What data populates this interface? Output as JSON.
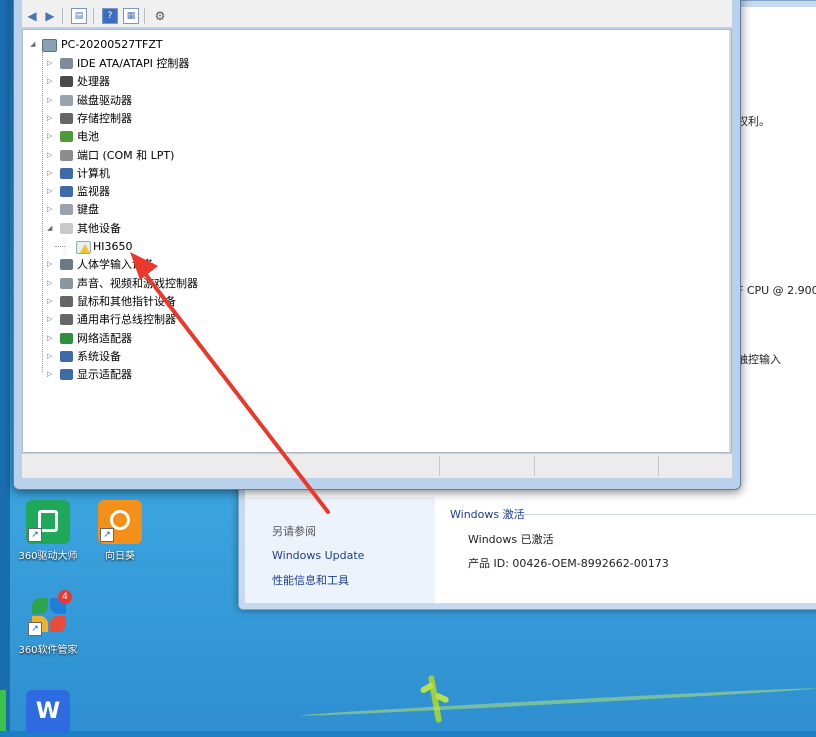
{
  "device_manager": {
    "root": "PC-20200527TFZT",
    "categories": [
      {
        "label": "IDE ATA/ATAPI 控制器",
        "icon": "ide-controller-icon"
      },
      {
        "label": "处理器",
        "icon": "processor-icon"
      },
      {
        "label": "磁盘驱动器",
        "icon": "disk-drive-icon"
      },
      {
        "label": "存储控制器",
        "icon": "storage-controller-icon"
      },
      {
        "label": "电池",
        "icon": "battery-icon"
      },
      {
        "label": "端口 (COM 和 LPT)",
        "icon": "port-icon"
      },
      {
        "label": "计算机",
        "icon": "computer-icon"
      },
      {
        "label": "监视器",
        "icon": "monitor-icon"
      },
      {
        "label": "键盘",
        "icon": "keyboard-icon"
      },
      {
        "label": "其他设备",
        "icon": "other-devices-icon",
        "expanded": true
      },
      {
        "label": "HI3650",
        "icon": "warning-device-icon",
        "child": true
      },
      {
        "label": "人体学输入设备",
        "icon": "hid-icon"
      },
      {
        "label": "声音、视频和游戏控制器",
        "icon": "sound-icon"
      },
      {
        "label": "鼠标和其他指针设备",
        "icon": "mouse-icon"
      },
      {
        "label": "通用串行总线控制器",
        "icon": "usb-icon"
      },
      {
        "label": "网络适配器",
        "icon": "network-adapter-icon"
      },
      {
        "label": "系统设备",
        "icon": "system-device-icon"
      },
      {
        "label": "显示适配器",
        "icon": "display-adapter-icon"
      }
    ]
  },
  "system_window": {
    "partial_text_1": "权利。",
    "partial_text_2": "F CPU @ 2.900",
    "partial_text_3": "触控输入",
    "see_also": "另请参阅",
    "link_windows_update": "Windows Update",
    "link_performance": "性能信息和工具",
    "activation_section": "Windows 激活",
    "activation_status": "Windows 已激活",
    "product_id": "产品 ID: 00426-OEM-8992662-00173"
  },
  "desktop": {
    "icons": [
      {
        "label": "360驱动大师",
        "color": "#1fa85a"
      },
      {
        "label": "向日葵",
        "color": "#f39019"
      },
      {
        "label": "360软件管家",
        "color": "#e84c3d",
        "badge": "4"
      },
      {
        "label": "",
        "color": "#2d6be0"
      }
    ]
  },
  "colors": {
    "annotation_arrow": "#e8392b",
    "warning": "#f1c232"
  }
}
